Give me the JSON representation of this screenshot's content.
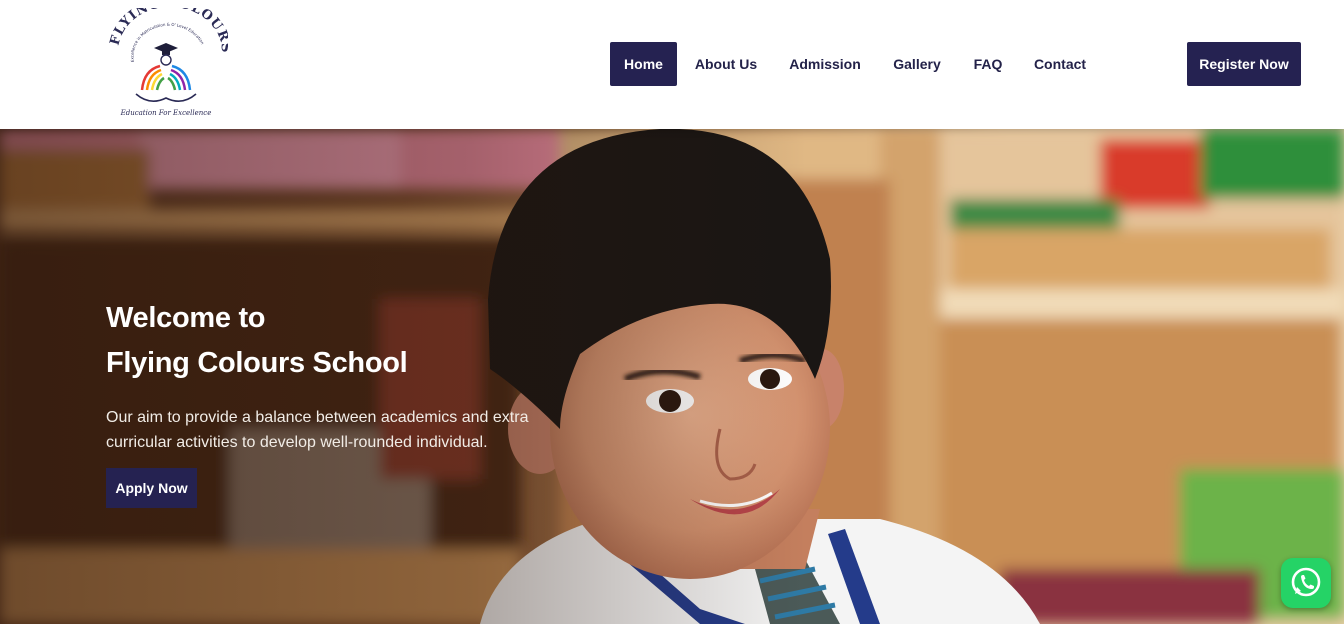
{
  "header": {
    "logo": {
      "name": "FLYING COLOURS",
      "subtitle": "Excellence in Matriculation & O' Level Education",
      "tagline": "Education For Excellence"
    },
    "nav": [
      {
        "label": "Home",
        "active": true
      },
      {
        "label": "About Us",
        "active": false
      },
      {
        "label": "Admission",
        "active": false
      },
      {
        "label": "Gallery",
        "active": false
      },
      {
        "label": "FAQ",
        "active": false
      },
      {
        "label": "Contact",
        "active": false
      }
    ],
    "register_label": "Register Now"
  },
  "hero": {
    "title_line1": "Welcome to",
    "title_line2": "Flying Colours School",
    "description": "Our aim to provide a balance between academics and extra curricular activities to develop well-rounded individual.",
    "apply_label": "Apply Now"
  },
  "icons": {
    "whatsapp": "whatsapp-icon"
  },
  "colors": {
    "brand_navy": "#252251",
    "whatsapp_green": "#25d366"
  }
}
